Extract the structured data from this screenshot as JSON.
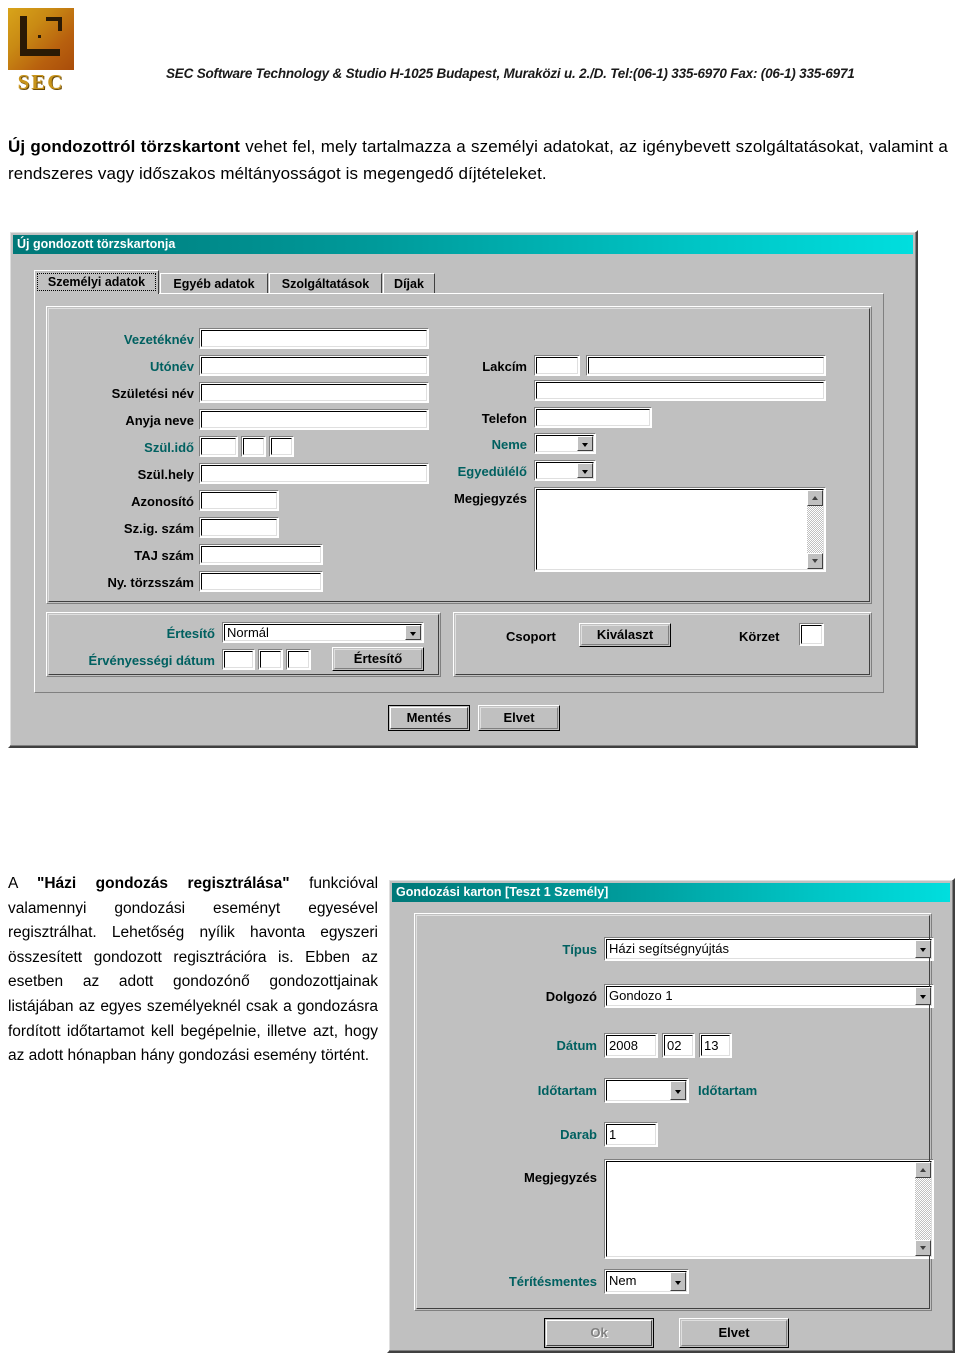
{
  "header": {
    "logo_text": "SEC",
    "company_line": "SEC Software Technology & Studio  H-1025 Budapest, Muraközi u. 2./D.  Tel:(06-1) 335-6970 Fax: (06-1) 335-6971"
  },
  "paragraphs": {
    "top_bold": "Új gondozottról törzskartont",
    "top_rest": " vehet fel, mely tartalmazza a személyi adatokat, az igénybevett szolgáltatásokat, valamint a rendszeres vagy időszakos méltányosságot is megengedő díjtételeket.",
    "left_lead": "A ",
    "left_bold": "\"Házi gondozás regisztrálása\"",
    "left_rest": " funkcióval valamennyi gondozási eseményt egyesével regisztrálhat. Lehetőség nyílik havonta egyszeri összesített gondozott regisztrációra is. Ebben az esetben az adott gondozónő gondozottjainak listájában az egyes személyeknél csak a gondozásra fordított időtartamot kell begépelnie, illetve azt, hogy az adott hónapban hány gondozási esemény történt."
  },
  "dialog1": {
    "title": "Új gondozott törzskartonja",
    "tabs": [
      {
        "label": "Személyi adatok",
        "selected": true
      },
      {
        "label": "Egyéb adatok",
        "selected": false
      },
      {
        "label": "Szolgáltatások",
        "selected": false
      },
      {
        "label": "Díjak",
        "selected": false
      }
    ],
    "left_fields": [
      {
        "label": "Vezetéknév",
        "value": ""
      },
      {
        "label": "Utónév",
        "value": ""
      },
      {
        "label": "Születési név",
        "value": ""
      },
      {
        "label": "Anyja neve",
        "value": ""
      },
      {
        "label": "Szül.idő",
        "value": ""
      },
      {
        "label": "Szül.hely",
        "value": ""
      },
      {
        "label": "Azonosító",
        "value": ""
      },
      {
        "label": "Sz.ig. szám",
        "value": ""
      },
      {
        "label": "TAJ szám",
        "value": ""
      },
      {
        "label": "Ny. törzsszám",
        "value": ""
      }
    ],
    "birth_date": {
      "year": "",
      "month": "",
      "day": ""
    },
    "right_fields": {
      "lakcim_label": "Lakcím",
      "lakcim_zip": "",
      "lakcim_street": "",
      "lakcim_street2": "",
      "telefon_label": "Telefon",
      "telefon": "",
      "neme_label": "Neme",
      "neme": "",
      "egyedulelo_label": "Egyedülélő",
      "egyedulelo": "",
      "megjegyzes_label": "Megjegyzés",
      "megjegyzes": ""
    },
    "notify": {
      "ertesito_label": "Értesítő",
      "ertesito_value": "Normál",
      "validity_label": "Érvényességi dátum",
      "validity": {
        "year": "",
        "month": "",
        "day": ""
      },
      "ertesito_button": "Értesítő"
    },
    "group": {
      "csoport_label": "Csoport",
      "select_button": "Kiválaszt",
      "korzet_label": "Körzet",
      "korzet_value": ""
    },
    "buttons": {
      "save": "Mentés",
      "cancel": "Elvet"
    }
  },
  "dialog2": {
    "title": "Gondozási karton [Teszt 1 Személy]",
    "fields": {
      "tipus_label": "Típus",
      "tipus_value": "Házi segítségnyújtás",
      "dolgozo_label": "Dolgozó",
      "dolgozo_value": "Gondozo 1",
      "datum_label": "Dátum",
      "datum_year": "2008",
      "datum_month": "02",
      "datum_day": "13",
      "idotartam_label": "Időtartam",
      "idotartam_value": "",
      "idotartam_unit": "Időtartam",
      "darab_label": "Darab",
      "darab_value": "1",
      "megjegyzes_label": "Megjegyzés",
      "megjegyzes_value": "",
      "teritesmentes_label": "Térítésmentes",
      "teritesmentes_value": "Nem"
    },
    "buttons": {
      "ok": "Ok",
      "cancel": "Elvet"
    }
  },
  "colors": {
    "titlebar_start": "#007878",
    "titlebar_end": "#00dede",
    "face": "#c0c0c0",
    "label_link": "#006060",
    "logo_gold": "#c8941c"
  }
}
